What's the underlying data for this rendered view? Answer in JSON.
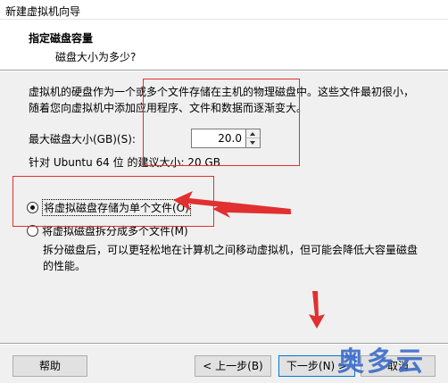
{
  "window": {
    "title": "新建虚拟机向导"
  },
  "header": {
    "title": "指定磁盘容量",
    "subtitle": "磁盘大小为多少?"
  },
  "body": {
    "description": "虚拟机的硬盘作为一个或多个文件存储在主机的物理磁盘中。这些文件最初很小，随着您向虚拟机中添加应用程序、文件和数据而逐渐变大。",
    "size_label": "最大磁盘大小(GB)(S):",
    "size_value": "20.0",
    "recommendation": "针对 Ubuntu 64 位 的建议大小: 20 GB",
    "options": [
      {
        "label": "将虚拟磁盘存储为单个文件(O)",
        "checked": true
      },
      {
        "label": "将虚拟磁盘拆分成多个文件(M)",
        "checked": false
      }
    ],
    "split_description": "拆分磁盘后，可以更轻松地在计算机之间移动虚拟机，但可能会降低大容量磁盘的性能。"
  },
  "buttons": {
    "help": "帮助",
    "back": "< 上一步(B)",
    "next": "下一步(N) >",
    "cancel": "取消"
  },
  "watermark": {
    "text": "奥多云"
  },
  "colors": {
    "annotation": "#e03030",
    "watermark": "#3a6bc8"
  }
}
